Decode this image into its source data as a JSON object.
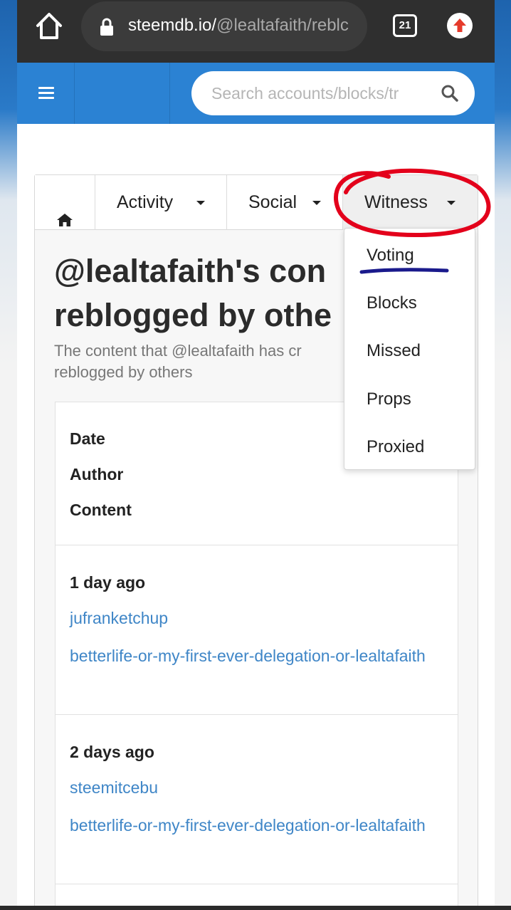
{
  "browser": {
    "url_host": "steemdb.io/",
    "url_path": "@lealtafaith/reblc",
    "tab_count": "21",
    "icons": [
      "home-icon",
      "lock-icon",
      "tabs-icon",
      "update-icon"
    ]
  },
  "navbar": {
    "search_placeholder": "Search accounts/blocks/tr",
    "brand_color": "#2b82d3",
    "icons": [
      "hamburger-icon",
      "search-icon"
    ]
  },
  "tabs": {
    "activity": "Activity",
    "social": "Social",
    "witness": "Witness"
  },
  "dropdown": {
    "items": [
      "Voting",
      "Blocks",
      "Missed",
      "Props",
      "Proxied"
    ]
  },
  "page": {
    "title_line1": "@lealtafaith's con",
    "title_line2": "reblogged by othe",
    "subtitle_line1": "The content that @lealtafaith has cr",
    "subtitle_line2": "reblogged by others"
  },
  "table": {
    "headers": [
      "Date",
      "Author",
      "Content"
    ],
    "rows": [
      {
        "date": "1 day ago",
        "author": "jufranketchup",
        "content": "betterlife-or-my-first-ever-delegation-or-lealtafaith"
      },
      {
        "date": "2 days ago",
        "author": "steemitcebu",
        "content": "betterlife-or-my-first-ever-delegation-or-lealtafaith"
      }
    ]
  },
  "colors": {
    "link": "#3f86c7",
    "annotation_circle": "#e3001b",
    "annotation_underline": "#1a1a8c"
  }
}
